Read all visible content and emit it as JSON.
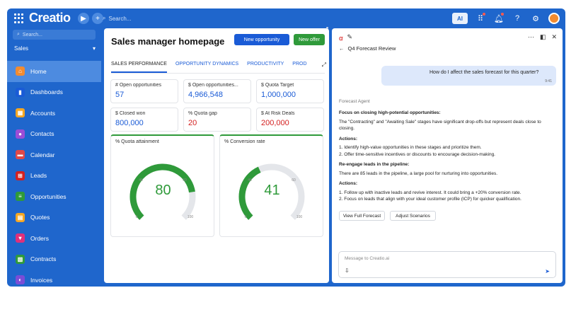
{
  "app": {
    "name": "Creatio"
  },
  "topbar": {
    "search_placeholder": "Search...",
    "ai_label": "AI"
  },
  "sidebar": {
    "search_placeholder": "Search...",
    "workspace": "Sales",
    "items": [
      {
        "label": "Home",
        "icon": "home-icon",
        "color": "#f28b30",
        "glyph": "⌂"
      },
      {
        "label": "Dashboards",
        "icon": "dashboards-icon",
        "color": "#1a5bd6",
        "glyph": "▮"
      },
      {
        "label": "Accounts",
        "icon": "accounts-icon",
        "color": "#f4a623",
        "glyph": "▦"
      },
      {
        "label": "Contacts",
        "icon": "contacts-icon",
        "color": "#9b4dd6",
        "glyph": "●"
      },
      {
        "label": "Calendar",
        "icon": "calendar-icon",
        "color": "#e04848",
        "glyph": "▬"
      },
      {
        "label": "Leads",
        "icon": "leads-icon",
        "color": "#d42020",
        "glyph": "⊞"
      },
      {
        "label": "Opportunities",
        "icon": "opportunities-icon",
        "color": "#2f9a3a",
        "glyph": "≡"
      },
      {
        "label": "Quotes",
        "icon": "quotes-icon",
        "color": "#f4a623",
        "glyph": "▤"
      },
      {
        "label": "Orders",
        "icon": "orders-icon",
        "color": "#e0307a",
        "glyph": "▾"
      },
      {
        "label": "Contracts",
        "icon": "contracts-icon",
        "color": "#2f9a3a",
        "glyph": "▧"
      },
      {
        "label": "Invoices",
        "icon": "invoices-icon",
        "color": "#7a4dd6",
        "glyph": "◐"
      }
    ]
  },
  "main": {
    "title": "Sales manager homepage",
    "new_opportunity": "New opportunity",
    "new_offer": "New offer",
    "tabs": [
      "SALES PERFORMANCE",
      "OPPORTUNITY DYNAMICS",
      "PRODUCTIVITY",
      "PROD"
    ],
    "kpis": [
      {
        "label": "# Open opportunities",
        "value": "57"
      },
      {
        "label": "$ Open opportunities...",
        "value": "4,966,548"
      },
      {
        "label": "$ Quota Target",
        "value": "1,000,000"
      },
      {
        "label": "$ Closed won",
        "value": "800,000"
      },
      {
        "label": "% Quota gap",
        "value": "20"
      },
      {
        "label": "$ At Risk Deals",
        "value": "200,000"
      }
    ],
    "gauges": [
      {
        "label": "% Quota attainment",
        "value": "80",
        "level": 80,
        "min": "0",
        "max": "100",
        "t1": "40",
        "t2": "60"
      },
      {
        "label": "% Conversion rate",
        "value": "41",
        "level": 41,
        "min": "0",
        "max": "100",
        "t1": "40",
        "t2": "60"
      }
    ]
  },
  "assistant": {
    "title": "Q4 Forecast Review",
    "user_message": "How do I affect the sales forecast for this quarter?",
    "user_time": "9:41",
    "agent_name": "Forecast Agent",
    "h1": "Focus on closing high-potential opportunities:",
    "p1": "The \"Contracting\" and \"Awaiting Sale\" stages have significant drop-offs but represent deals close to closing.",
    "actions1": "Actions:",
    "a1": "1. Identify high-value opportunities in these stages and prioritize them.",
    "a2": "2. Offer time-sensitive incentives or discounts to encourage decision-making.",
    "h2": "Re-engage leads in the pipeline:",
    "p2": "There are 85 leads in the pipeline, a large pool for nurturing into opportunities.",
    "actions2": "Actions:",
    "b1": "1. Follow up with inactive leads and revive interest. It could bring a +20% conversion rate.",
    "b2": "2. Focus on leads that align with your ideal customer profile (ICP) for quicker qualification.",
    "btn_full": "View Full Forecast",
    "btn_adjust": "Adjust Scenarios",
    "input_placeholder": "Message to Creatio.ai"
  }
}
